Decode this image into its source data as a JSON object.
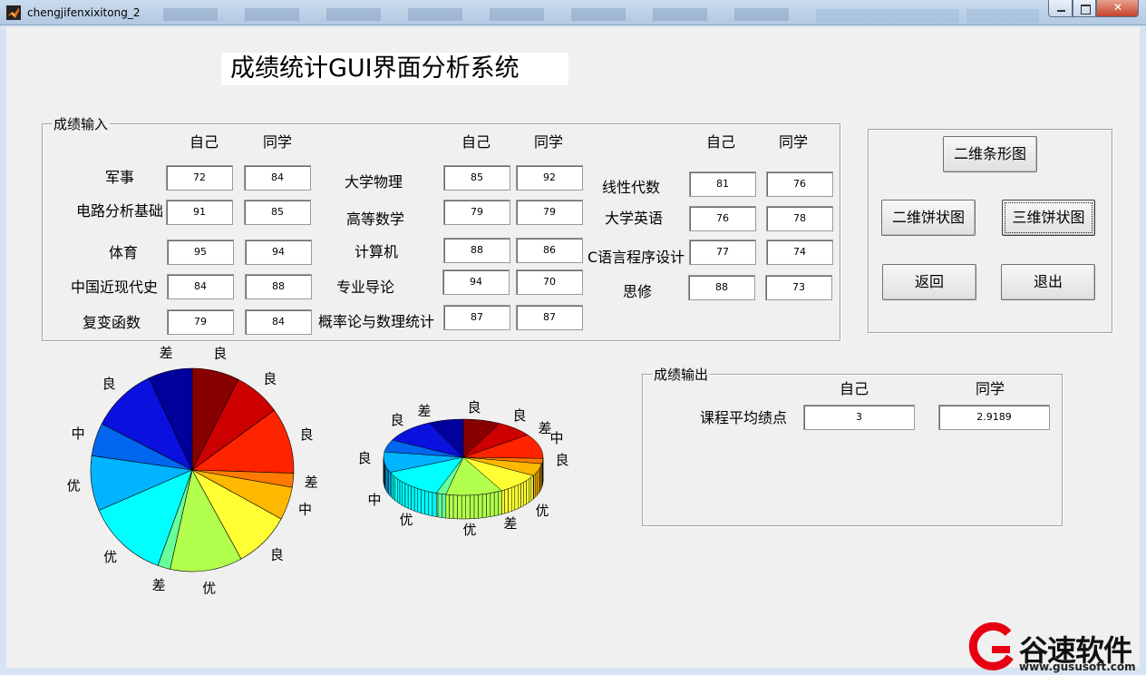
{
  "window": {
    "title": "chengjifenxixitong_2"
  },
  "main_title": "成绩统计GUI界面分析系统",
  "input_panel": {
    "title": "成绩输入",
    "col_self": "自己",
    "col_classmate": "同学",
    "courses": [
      {
        "name": "军事",
        "self": "72",
        "classmate": "84"
      },
      {
        "name": "电路分析基础",
        "self": "91",
        "classmate": "85"
      },
      {
        "name": "体育",
        "self": "95",
        "classmate": "94"
      },
      {
        "name": "中国近现代史",
        "self": "84",
        "classmate": "88"
      },
      {
        "name": "复变函数",
        "self": "79",
        "classmate": "84"
      },
      {
        "name": "大学物理",
        "self": "85",
        "classmate": "92"
      },
      {
        "name": "高等数学",
        "self": "79",
        "classmate": "79"
      },
      {
        "name": "计算机",
        "self": "88",
        "classmate": "86"
      },
      {
        "name": "专业导论",
        "self": "94",
        "classmate": "70"
      },
      {
        "name": "概率论与数理统计",
        "self": "87",
        "classmate": "87"
      },
      {
        "name": "线性代数",
        "self": "81",
        "classmate": "76"
      },
      {
        "name": "大学英语",
        "self": "76",
        "classmate": "78"
      },
      {
        "name": "C语言程序设计",
        "self": "77",
        "classmate": "74"
      },
      {
        "name": "思修",
        "self": "88",
        "classmate": "73"
      }
    ]
  },
  "buttons": {
    "bar2d": "二维条形图",
    "pie2d": "二维饼状图",
    "pie3d": "三维饼状图",
    "back": "返回",
    "exit": "退出"
  },
  "output_panel": {
    "title": "成绩输出",
    "col_self": "自己",
    "col_classmate": "同学",
    "row_label": "课程平均绩点",
    "self_value": "3",
    "classmate_value": "2.9189"
  },
  "pie2d": {
    "labels": [
      "良",
      "良",
      "良",
      "差",
      "中",
      "良",
      "优",
      "差",
      "优",
      "优",
      "中",
      "良",
      "差"
    ],
    "colors": [
      "#880000",
      "#cc0000",
      "#ff2400",
      "#ff7a00",
      "#ffb800",
      "#ffff33",
      "#b3ff4d",
      "#66ff99",
      "#00ffff",
      "#00b4ff",
      "#0066ee",
      "#0a10dd",
      "#00009a"
    ]
  },
  "pie3d": {
    "labels": [
      "良",
      "良",
      "差",
      "中",
      "良",
      "优",
      "差",
      "优",
      "优",
      "中",
      "良",
      "良",
      "差"
    ]
  },
  "watermark": {
    "brand": "谷速软件",
    "url": "www.gususoft.com"
  }
}
